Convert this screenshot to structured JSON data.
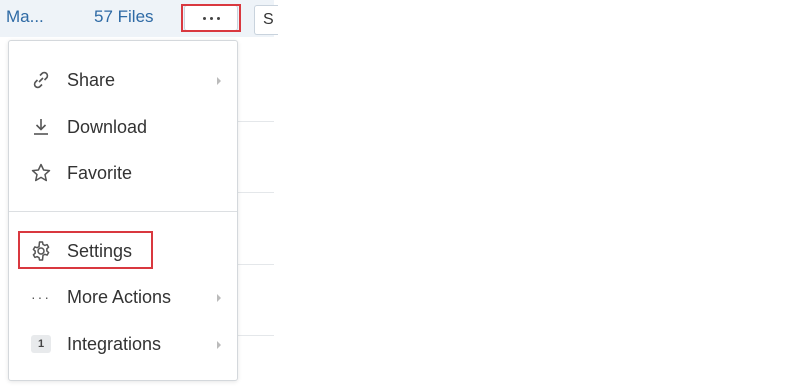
{
  "header": {
    "breadcrumb": "Ma...",
    "file_count": "57 Files",
    "side_button_label": "S"
  },
  "menu": {
    "items": [
      {
        "label": "Share",
        "icon": "share-icon",
        "submenu": true
      },
      {
        "label": "Download",
        "icon": "download-icon",
        "submenu": false
      },
      {
        "label": "Favorite",
        "icon": "star-icon",
        "submenu": false
      },
      {
        "label": "Settings",
        "icon": "gear-icon",
        "submenu": false
      },
      {
        "label": "More Actions",
        "icon": "ellipsis-icon",
        "submenu": true
      },
      {
        "label": "Integrations",
        "icon": "integrations-badge",
        "badge": "1",
        "submenu": true
      }
    ]
  },
  "colors": {
    "highlight": "#d9383f",
    "link": "#2e6aa5",
    "text": "#333333"
  }
}
